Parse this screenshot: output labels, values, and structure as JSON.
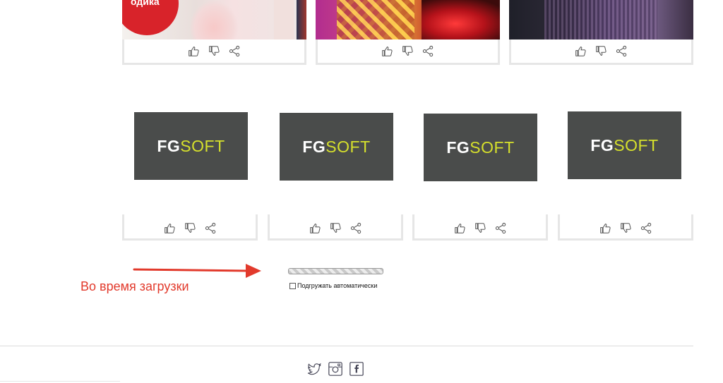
{
  "top_cards": [
    {
      "name": "card-1",
      "badge_text": "одика"
    },
    {
      "name": "card-2"
    },
    {
      "name": "card-3"
    }
  ],
  "logos": [
    {
      "fg": "FG",
      "soft": "SOFT"
    },
    {
      "fg": "FG",
      "soft": "SOFT"
    },
    {
      "fg": "FG",
      "soft": "SOFT"
    },
    {
      "fg": "FG",
      "soft": "SOFT"
    }
  ],
  "annotation": {
    "text": "Во время загрузки",
    "color": "#e23a2c"
  },
  "loader": {
    "autoload_label": "Подгружать автоматически",
    "autoload_checked": false
  },
  "icons": {
    "like": "thumbs-up-icon",
    "dislike": "thumbs-down-icon",
    "share": "share-icon",
    "social": [
      "twitter-icon",
      "instagram-icon",
      "facebook-icon"
    ]
  },
  "colors": {
    "logo_bg": "#4a4c4b",
    "logo_accent": "#d6e02c",
    "card_border": "#e6e6e6"
  }
}
